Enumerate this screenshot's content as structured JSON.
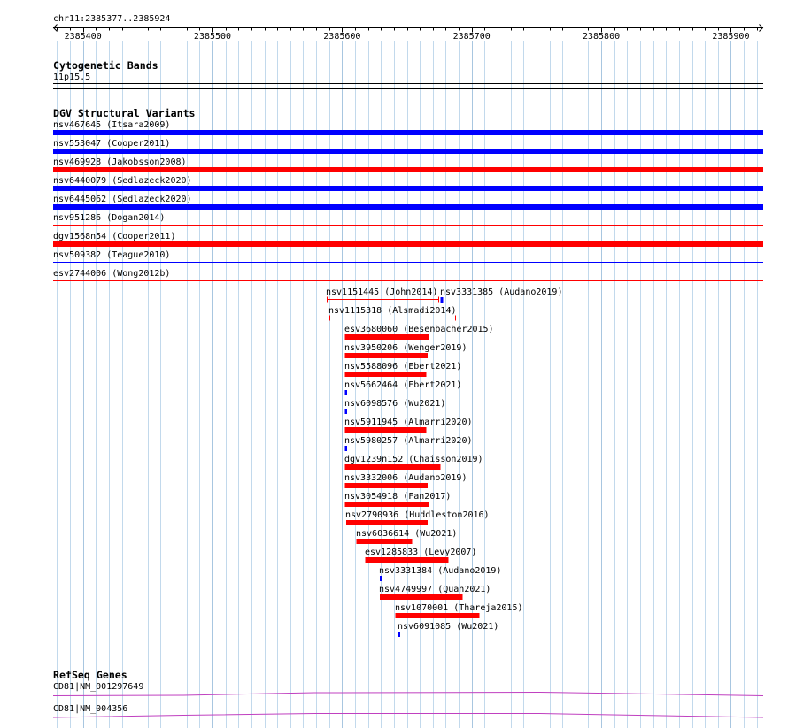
{
  "location": "chr11:2385377..2385924",
  "ruler": {
    "ticks": [
      "2385400",
      "2385500",
      "2385600",
      "2385700",
      "2385800",
      "2385900"
    ]
  },
  "colors": {
    "grid": "#c2d9ec",
    "grid_major": "#a8c6e0",
    "gene": "#c040c0"
  },
  "tracks": {
    "cytoband": {
      "title": "Cytogenetic Bands",
      "band": "11p15.5"
    },
    "dgv": {
      "title": "DGV Structural Variants",
      "rows": [
        [
          {
            "label": "nsv467645 (Itsara2009)",
            "start": 2385377,
            "end": 2385924,
            "glyph": "box",
            "color": "#0000ff"
          }
        ],
        [
          {
            "label": "nsv553047 (Cooper2011)",
            "start": 2385377,
            "end": 2385924,
            "glyph": "box",
            "color": "#0000ff"
          }
        ],
        [
          {
            "label": "nsv469928 (Jakobsson2008)",
            "start": 2385377,
            "end": 2385924,
            "glyph": "box",
            "color": "#ff0000"
          }
        ],
        [
          {
            "label": "nsv6440079 (Sedlazeck2020)",
            "start": 2385377,
            "end": 2385924,
            "glyph": "box",
            "color": "#0000ff"
          }
        ],
        [
          {
            "label": "nsv6445062 (Sedlazeck2020)",
            "start": 2385377,
            "end": 2385924,
            "glyph": "box",
            "color": "#0000ff"
          }
        ],
        [
          {
            "label": "nsv951286 (Dogan2014)",
            "start": 2385377,
            "end": 2385924,
            "glyph": "line",
            "color": "#ff0000"
          }
        ],
        [
          {
            "label": "dgv1568n54 (Cooper2011)",
            "start": 2385377,
            "end": 2385924,
            "glyph": "box",
            "color": "#ff0000"
          }
        ],
        [
          {
            "label": "nsv509382 (Teague2010)",
            "start": 2385377,
            "end": 2385924,
            "glyph": "line",
            "color": "#0000ff"
          }
        ],
        [
          {
            "label": "esv2744006 (Wong2012b)",
            "start": 2385377,
            "end": 2385924,
            "glyph": "line",
            "color": "#ff0000"
          }
        ],
        [
          {
            "label": "nsv1151445 (John2014)",
            "start": 2385588,
            "end": 2385674,
            "glyph": "span",
            "color": "#ff0000"
          },
          {
            "label": "nsv3331385 (Audano2019)",
            "start": 2385676,
            "end": 2385677,
            "glyph": "box",
            "color": "#0000ff"
          }
        ],
        [
          {
            "label": "nsv1115318 (Alsmadi2014)",
            "start": 2385590,
            "end": 2385687,
            "glyph": "span",
            "color": "#ff0000"
          }
        ],
        [
          {
            "label": "esv3680060 (Besenbacher2015)",
            "start": 2385602,
            "end": 2385666,
            "glyph": "box",
            "color": "#ff0000"
          }
        ],
        [
          {
            "label": "nsv3950206 (Wenger2019)",
            "start": 2385602,
            "end": 2385665,
            "glyph": "box",
            "color": "#ff0000"
          }
        ],
        [
          {
            "label": "nsv5588096 (Ebert2021)",
            "start": 2385602,
            "end": 2385664,
            "glyph": "box",
            "color": "#ff0000"
          }
        ],
        [
          {
            "label": "nsv5662464 (Ebert2021)",
            "start": 2385602,
            "end": 2385603,
            "glyph": "box",
            "color": "#0000ff"
          }
        ],
        [
          {
            "label": "nsv6098576 (Wu2021)",
            "start": 2385602,
            "end": 2385603,
            "glyph": "box",
            "color": "#0000ff"
          }
        ],
        [
          {
            "label": "nsv5911945 (Almarri2020)",
            "start": 2385602,
            "end": 2385664,
            "glyph": "box",
            "color": "#ff0000"
          }
        ],
        [
          {
            "label": "nsv5980257 (Almarri2020)",
            "start": 2385602,
            "end": 2385603,
            "glyph": "box",
            "color": "#0000ff"
          }
        ],
        [
          {
            "label": "dgv1239n152 (Chaisson2019)",
            "start": 2385602,
            "end": 2385675,
            "glyph": "box",
            "color": "#ff0000"
          }
        ],
        [
          {
            "label": "nsv3332006 (Audano2019)",
            "start": 2385602,
            "end": 2385665,
            "glyph": "box",
            "color": "#ff0000"
          }
        ],
        [
          {
            "label": "nsv3054918 (Fan2017)",
            "start": 2385602,
            "end": 2385666,
            "glyph": "box",
            "color": "#ff0000"
          }
        ],
        [
          {
            "label": "nsv2790936 (Huddleston2016)",
            "start": 2385603,
            "end": 2385665,
            "glyph": "box",
            "color": "#ff0000"
          }
        ],
        [
          {
            "label": "nsv6036614 (Wu2021)",
            "start": 2385611,
            "end": 2385653,
            "glyph": "box",
            "color": "#ff0000"
          }
        ],
        [
          {
            "label": "esv1285833 (Levy2007)",
            "start": 2385618,
            "end": 2385681,
            "glyph": "box",
            "color": "#ff0000"
          }
        ],
        [
          {
            "label": "nsv3331384 (Audano2019)",
            "start": 2385629,
            "end": 2385630,
            "glyph": "box",
            "color": "#0000ff"
          }
        ],
        [
          {
            "label": "nsv4749997 (Quan2021)",
            "start": 2385629,
            "end": 2385692,
            "glyph": "box",
            "color": "#ff0000"
          }
        ],
        [
          {
            "label": "nsv1070001 (Thareja2015)",
            "start": 2385641,
            "end": 2385705,
            "glyph": "box",
            "color": "#ff0000"
          }
        ],
        [
          {
            "label": "nsv6091085 (Wu2021)",
            "start": 2385643,
            "end": 2385644,
            "glyph": "box",
            "color": "#0000ff"
          }
        ]
      ]
    },
    "refseq": {
      "title": "RefSeq Genes",
      "transcripts": [
        {
          "label": "CD81|NM_001297649"
        },
        {
          "label": "CD81|NM_004356"
        }
      ]
    }
  }
}
